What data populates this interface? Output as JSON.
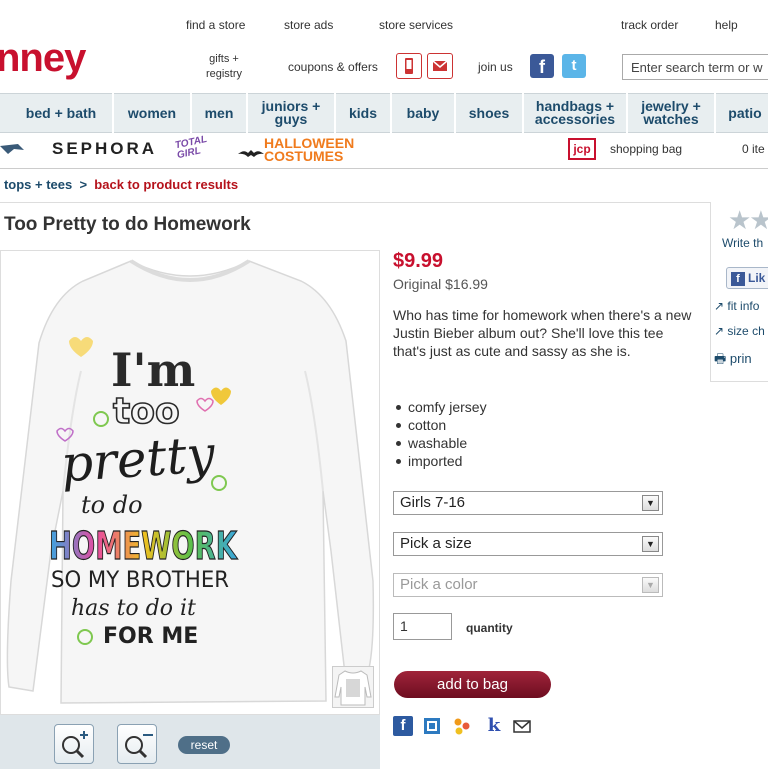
{
  "header": {
    "logo": "nney",
    "top_links": [
      "find a store",
      "store ads",
      "store services",
      "track order",
      "help"
    ],
    "gifts_registry": "gifts + registry",
    "coupons": "coupons & offers",
    "join_us": "join us",
    "search_placeholder": "Enter search term or w"
  },
  "nav": {
    "items": [
      "bed + bath",
      "women",
      "men",
      "juniors + guys",
      "kids",
      "baby",
      "shoes",
      "handbags + accessories",
      "jewelry + watches",
      "patio"
    ]
  },
  "brands": {
    "sephora": "SEPHORA",
    "halloween": "HALLOWEEN COSTUMES",
    "jcp": "jcp",
    "shopping_bag": "shopping bag",
    "bag_count": "0 ite"
  },
  "breadcrumb": {
    "trail": "› tops + tees",
    "back": "back to product results"
  },
  "product": {
    "title": "Too Pretty to do Homework",
    "price": "$9.99",
    "original": "Original $16.99",
    "description": "Who has time for homework when there's a new Justin Bieber album out? She'll love this tee that's just as cute and sassy as she is.",
    "features": [
      "comfy jersey",
      "cotton",
      "washable",
      "imported"
    ],
    "size_range": "Girls 7-16",
    "size_select": "Pick a size",
    "color_select": "Pick a color",
    "quantity": "1",
    "quantity_label": "quantity",
    "add_to_bag": "add to bag",
    "shirt_text": {
      "line1": "I'm",
      "line2": "too",
      "line3": "pretty",
      "line4": "to do",
      "line5": "HOMEWORK",
      "line6": "SO MY BROTHER",
      "line7": "has to do it",
      "line8": "FOR ME"
    }
  },
  "zoom": {
    "reset": "reset"
  },
  "side": {
    "write_review": "Write th",
    "like": "Lik",
    "fit_info": "fit info",
    "size_chart": "size ch",
    "print": "prin"
  },
  "colors": {
    "brand_red": "#c8102e",
    "nav_text": "#1d4b6b",
    "add_bag": "#8b1a30"
  }
}
